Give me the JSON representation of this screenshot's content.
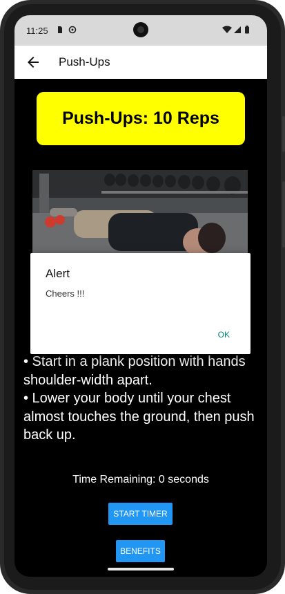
{
  "status_bar": {
    "time": "11:25"
  },
  "app_bar": {
    "title": "Push-Ups",
    "back_icon": "arrow-left-icon"
  },
  "exercise": {
    "banner": "Push-Ups: 10 Reps"
  },
  "dialog": {
    "title": "Alert",
    "message": "Cheers !!!",
    "ok_label": "OK"
  },
  "instructions": [
    "• Start in a plank position with hands shoulder-width apart.",
    "• Lower your body until your chest almost touches the ground, then push back up."
  ],
  "timer": {
    "remaining_text": "Time Remaining: 0 seconds",
    "start_label": "START TIMER"
  },
  "benefits": {
    "label": "BENEFITS"
  },
  "colors": {
    "banner": "#ffff00",
    "button": "#2196f3",
    "dialog_accent": "#00877a",
    "background": "#000000"
  }
}
